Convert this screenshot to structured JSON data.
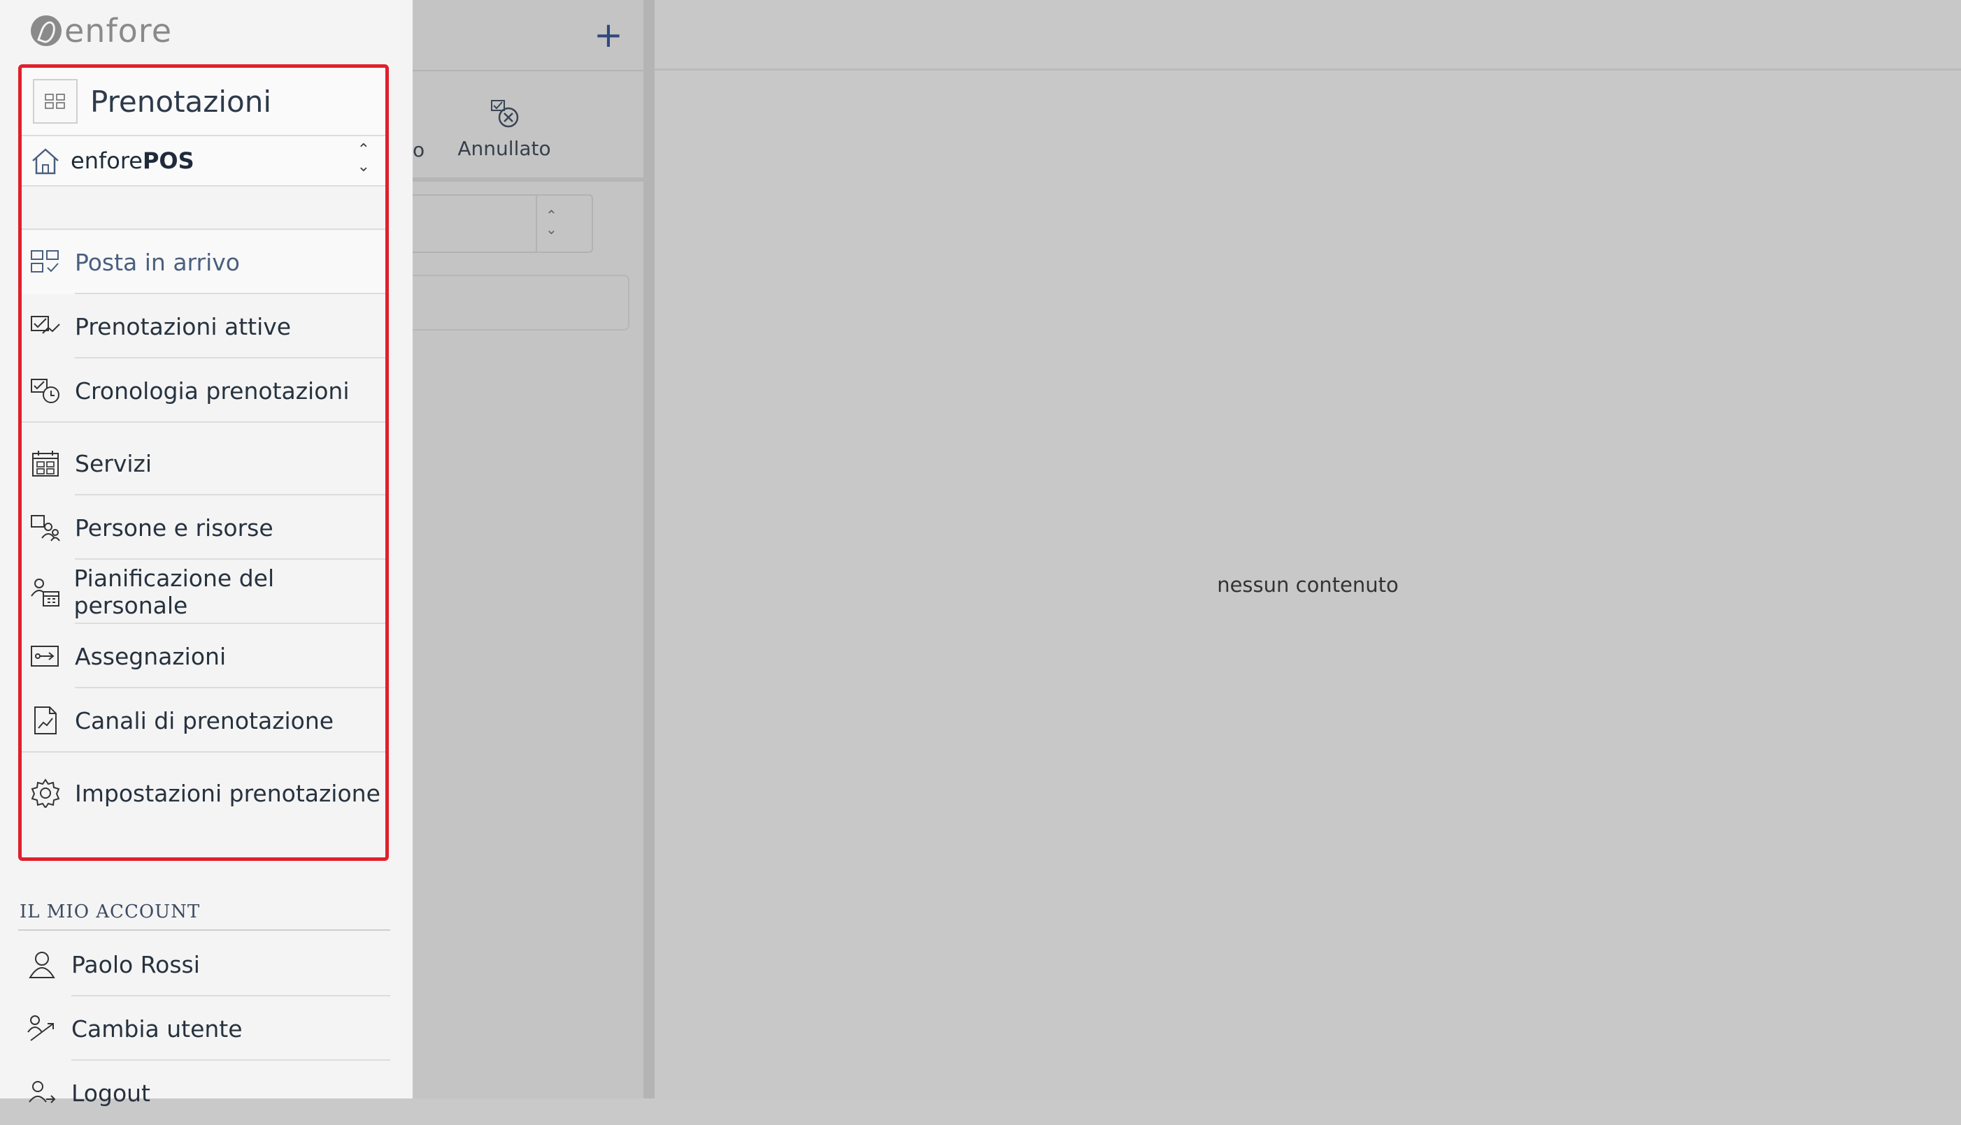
{
  "background": {
    "add_icon": "plus-icon",
    "tab_fragment": "o",
    "tab_cancel_label": "Annullato",
    "empty_text": "nessun contenuto"
  },
  "sidebar": {
    "logo_text": "enfore",
    "app_title": "Prenotazioni",
    "store_prefix": "enfore",
    "store_suffix": "POS",
    "menu": [
      {
        "label": "Posta in arrivo",
        "icon": "inbox-icon",
        "selected": true
      },
      {
        "label": "Prenotazioni attive",
        "icon": "active-bookings-icon"
      },
      {
        "label": "Cronologia prenotazioni",
        "icon": "booking-history-icon"
      },
      {
        "label": "Servizi",
        "icon": "calendar-grid-icon"
      },
      {
        "label": "Persone e risorse",
        "icon": "people-resources-icon"
      },
      {
        "label": "Pianificazione del personale",
        "icon": "staff-planning-icon"
      },
      {
        "label": "Assegnazioni",
        "icon": "assignment-icon"
      },
      {
        "label": "Canali di prenotazione",
        "icon": "channel-report-icon"
      },
      {
        "label": "Impostazioni prenotazione",
        "icon": "gear-icon"
      }
    ],
    "account_section_title": "IL MIO ACCOUNT",
    "account": [
      {
        "label": "Paolo Rossi",
        "icon": "user-icon"
      },
      {
        "label": "Cambia utente",
        "icon": "switch-user-icon"
      },
      {
        "label": "Logout",
        "icon": "logout-icon"
      }
    ]
  },
  "colors": {
    "highlight": "#e0202b",
    "accent": "#2f4a7a",
    "sidebar_bg": "#f4f4f4",
    "overlay_bg": "#c8c8c8"
  }
}
